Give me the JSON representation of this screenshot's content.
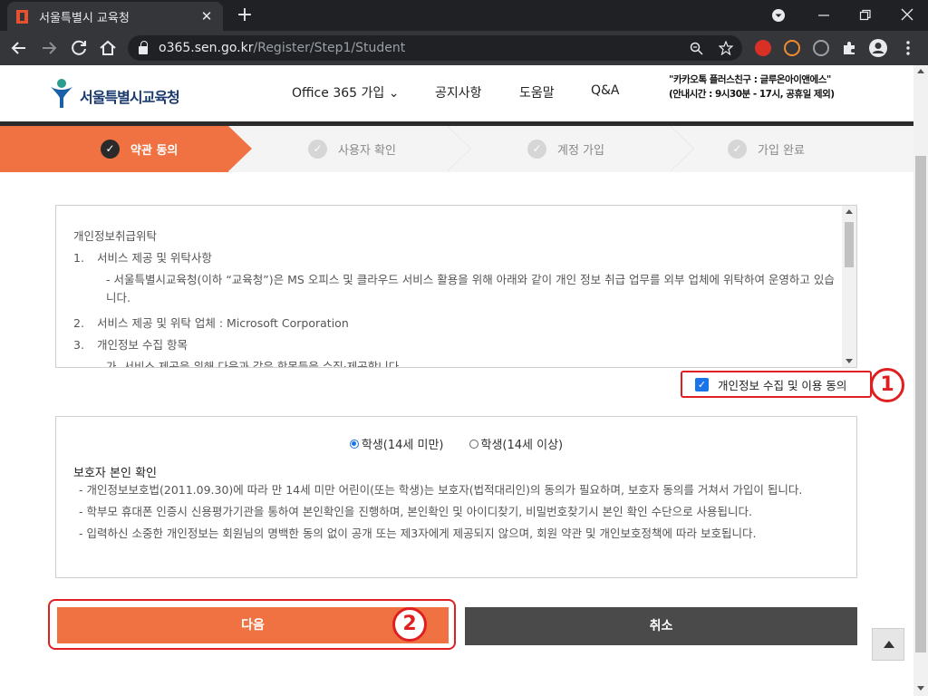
{
  "browser": {
    "tab_title": "서울특별시 교육청",
    "close_glyph": "✕",
    "new_tab_glyph": "+",
    "url_host": "o365.sen.go.kr",
    "url_path": "/Register/Step1/Student"
  },
  "header": {
    "logo_text": "서울특별시교육청",
    "nav": [
      "Office 365 가입",
      "공지사항",
      "도움말",
      "Q&A"
    ],
    "nav_dropdown_glyph": "⌄",
    "kakao_line1": "\"카카오톡 플러스친구 : 글루온아이앤에스\"",
    "kakao_line2": "(안내시간 : 9시30분 - 17시, 공휴일 제외)"
  },
  "steps": [
    {
      "label": "약관 동의",
      "active": true
    },
    {
      "label": "사용자 확인",
      "active": false
    },
    {
      "label": "계정 가입",
      "active": false
    },
    {
      "label": "가입 완료",
      "active": false
    }
  ],
  "terms": {
    "heading": "개인정보취급위탁",
    "item1_num": "1.",
    "item1": "서비스 제공 및 위탁사항",
    "item1_detail": "- 서울특별시교육청(이하 “교육청”)은 MS 오피스 및 클라우드 서비스 활용을 위해 아래와 같이 개인 정보 취급 업무를 외부 업체에 위탁하여 운영하고 있습니다.",
    "item2_num": "2.",
    "item2": "서비스 제공 및 위탁 업체 : Microsoft Corporation",
    "item3_num": "3.",
    "item3": "개인정보 수집 항목",
    "item3_detail": "가. 서비스 제공을 위해 다음과 같은 항목들을 수집·제공합니다."
  },
  "agree": {
    "label": "개인정보 수집 및 이용 동의",
    "checked": true,
    "badge": "1"
  },
  "guardian": {
    "radio_under14": "학생(14세 미만)",
    "radio_over14": "학생(14세 이상)",
    "selected": "under14",
    "title": "보호자 본인 확인",
    "lines": [
      "- 개인정보보호법(2011.09.30)에 따라 만 14세 미만 어린이(또는 학생)는 보호자(법적대리인)의 동의가 필요하며, 보호자 동의를 거쳐서 가입이 됩니다.",
      "- 학부모 휴대폰 인증시 신용평가기관을 통하여 본인확인을 진행하며, 본인확인 및 아이디찾기, 비밀번호찾기시 본인 확인 수단으로 사용됩니다.",
      "- 입력하신 소중한 개인정보는 회원님의 명백한 동의 없이 공개 또는 제3자에게 제공되지 않으며, 회원 약관 및 개인보호정책에 따라 보호됩니다."
    ]
  },
  "buttons": {
    "next": "다음",
    "next_badge": "2",
    "cancel": "취소"
  },
  "colors": {
    "accent": "#f07242",
    "annotation": "#e02020",
    "cancel_bg": "#4a4a4a"
  }
}
